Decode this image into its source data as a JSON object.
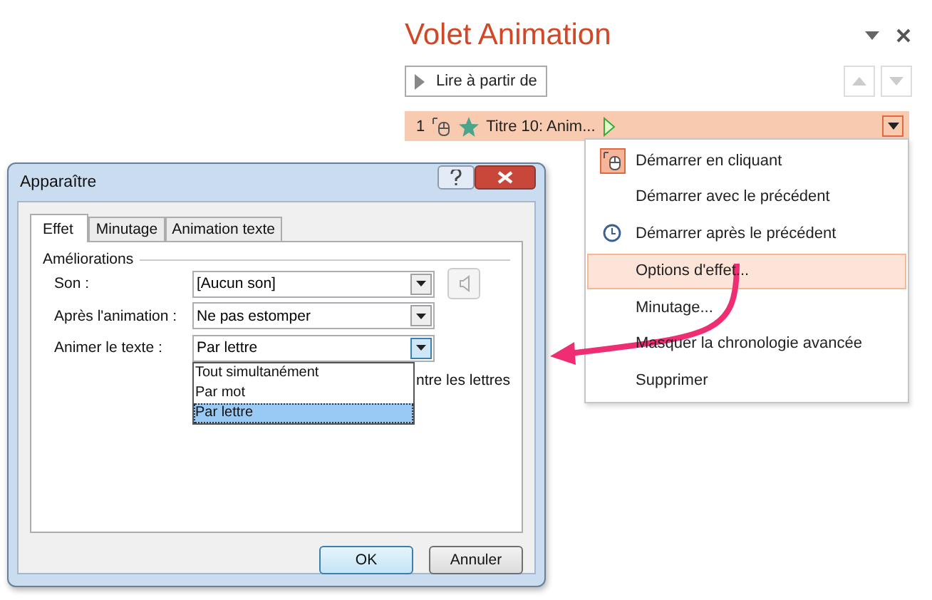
{
  "pane": {
    "title": "Volet Animation",
    "play_button": "Lire à partir de",
    "item": {
      "number": "1",
      "label": "Titre 10: Anim...",
      "selected": true
    },
    "menu": [
      {
        "label": "Démarrer en cliquant",
        "kind": "mouse",
        "selected": false
      },
      {
        "label": "Démarrer avec le précédent",
        "kind": "plain",
        "selected": false
      },
      {
        "label": "Démarrer après le précédent",
        "kind": "clock",
        "selected": false
      },
      {
        "label": "Options d'effet...",
        "kind": "plain",
        "selected": true
      },
      {
        "label": "Minutage...",
        "kind": "plain",
        "selected": false
      },
      {
        "label": "Masquer la chronologie avancée",
        "kind": "plain",
        "selected": false
      },
      {
        "label": "Supprimer",
        "kind": "plain",
        "selected": false
      }
    ]
  },
  "dialog": {
    "title": "Apparaître",
    "tabs": [
      {
        "label": "Effet",
        "selected": true
      },
      {
        "label": "Minutage",
        "selected": false
      },
      {
        "label": "Animation texte",
        "selected": false
      }
    ],
    "group": "Améliorations",
    "fields": [
      {
        "label": "Son :",
        "value": "[Aucun son]"
      },
      {
        "label": "Après l'animation :",
        "value": "Ne pas estomper"
      },
      {
        "label": "Animer le texte :",
        "value": "Par lettre"
      }
    ],
    "options": [
      {
        "label": "Tout simultanément",
        "selected": false
      },
      {
        "label": "Par mot",
        "selected": false
      },
      {
        "label": "Par lettre",
        "selected": true
      }
    ],
    "partial_text": "ntre les lettres",
    "buttons": [
      {
        "label": "OK",
        "default": true
      },
      {
        "label": "Annuler",
        "default": false
      }
    ]
  }
}
